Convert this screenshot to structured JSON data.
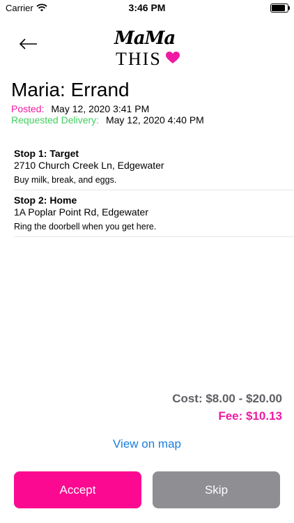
{
  "status_bar": {
    "carrier": "Carrier",
    "time": "3:46 PM"
  },
  "header": {
    "logo_top": "MaMa",
    "logo_bottom": "THIS"
  },
  "order": {
    "title": "Maria: Errand",
    "posted_label": "Posted:",
    "posted_value": "May 12, 2020 3:41 PM",
    "requested_label": "Requested Delivery:",
    "requested_value": "May 12, 2020 4:40 PM"
  },
  "stops": [
    {
      "name": "Stop 1: Target",
      "address": "2710 Church Creek Ln, Edgewater",
      "note": "Buy milk, break, and eggs."
    },
    {
      "name": "Stop 2: Home",
      "address": "1A Poplar Point Rd, Edgewater",
      "note": "Ring the doorbell when you get here."
    }
  ],
  "pricing": {
    "cost": "Cost: $8.00 - $20.00",
    "fee": "Fee: $10.13"
  },
  "actions": {
    "map_link": "View on map",
    "accept": "Accept",
    "skip": "Skip"
  },
  "colors": {
    "accent_pink": "#fb0a91",
    "posted_pink": "#ee1aa1",
    "requested_green": "#3fcf5f",
    "link_blue": "#1a7ee0",
    "skip_gray": "#8e8e93"
  },
  "icons": {
    "back": "arrow-left-icon",
    "wifi": "wifi-icon",
    "battery": "battery-icon",
    "heart": "heart-icon"
  }
}
